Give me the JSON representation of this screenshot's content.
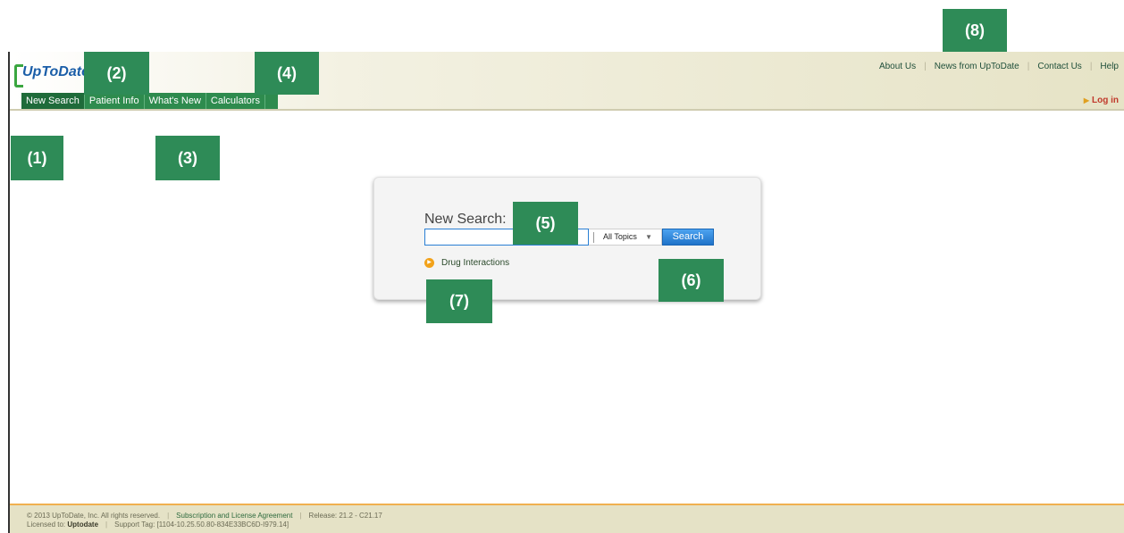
{
  "header": {
    "logo_text": "UpToDate",
    "nav": [
      "New Search",
      "Patient Info",
      "What's New",
      "Calculators"
    ],
    "top_links": [
      "About Us",
      "News from UpToDate",
      "Contact Us",
      "Help"
    ],
    "login": "Log in"
  },
  "search": {
    "title": "New Search:",
    "input_value": "",
    "topics_label": "All Topics",
    "button_label": "Search",
    "drug_link": "Drug Interactions"
  },
  "callouts": [
    "(1)",
    "(2)",
    "(3)",
    "(4)",
    "(5)",
    "(6)",
    "(7)",
    "(8)"
  ],
  "footer": {
    "copyright": "© 2013 UpToDate, Inc. All rights reserved.",
    "subscription": "Subscription and License Agreement",
    "release": "Release: 21.2 - C21.17",
    "licensed_label": "Licensed to:",
    "licensed_to": "Uptodate",
    "support_tag": "Support Tag: [1104-10.25.50.80-834E33BC6D-I979.14]"
  },
  "colors": {
    "nav_green": "#2e8b4e",
    "callout_green": "#2e8b57",
    "search_blue": "#1f73c9",
    "login_red": "#c0392b"
  }
}
